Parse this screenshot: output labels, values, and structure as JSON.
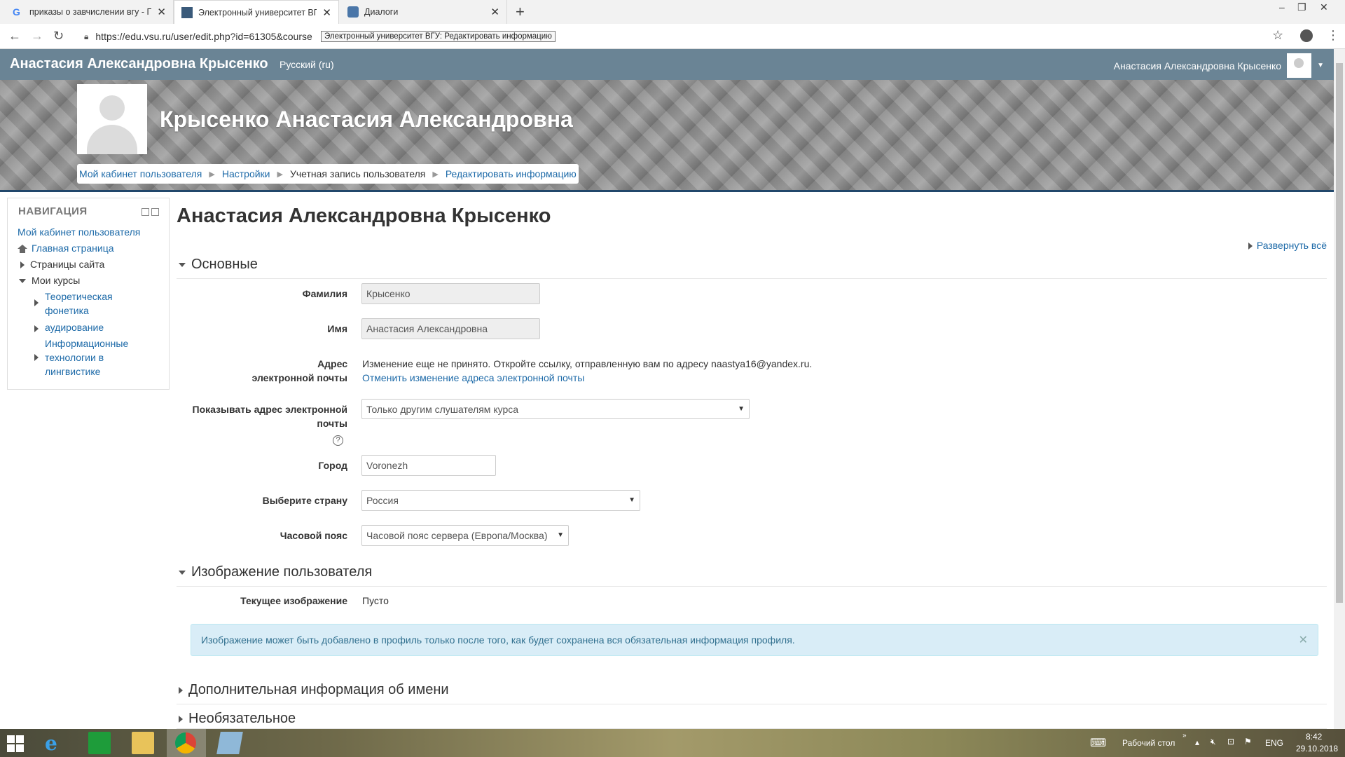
{
  "browser": {
    "tabs": [
      {
        "title": "приказы о завчислении вгу - По"
      },
      {
        "title": "Электронный университет ВГУ: Р"
      },
      {
        "title": "Диалоги"
      }
    ],
    "url": "https://edu.vsu.ru/user/edit.php?id=61305&course",
    "tooltip": "Электронный университет ВГУ: Редактировать информацию"
  },
  "topnav": {
    "site_name": "Анастасия Александровна Крысенко",
    "language": "Русский (ru)",
    "user_name": "Анастасия Александровна Крысенко"
  },
  "banner": {
    "title": "Крысенко Анастасия Александровна",
    "breadcrumb": [
      "Мой кабинет пользователя",
      "Настройки",
      "Учетная запись пользователя",
      "Редактировать информацию"
    ]
  },
  "navigation": {
    "title": "НАВИГАЦИЯ",
    "items": [
      "Мой кабинет пользователя",
      "Главная страница",
      "Страницы сайта",
      "Мои курсы",
      "Теоретическая",
      "фонетика",
      "аудирование",
      "Информационные",
      "технологии в",
      "лингвистике"
    ]
  },
  "main": {
    "heading": "Анастасия Александровна Крысенко",
    "expand_all": "Развернуть всё",
    "section_general": "Основные",
    "surname_label": "Фамилия",
    "surname_value": "Крысенко",
    "name_label": "Имя",
    "name_value": "Анастасия Александровна",
    "email_label_1": "Адрес",
    "email_label_2": "электронной почты",
    "email_notice": "Изменение еще не принято. Откройте ссылку, отправленную вам по адресу naastya16@yandex.ru.",
    "email_cancel": "Отменить изменение адреса электронной почты",
    "show_email_label_1": "Показывать адрес электронной",
    "show_email_label_2": "почты",
    "show_email_value": "Только другим слушателям курса",
    "city_label": "Город",
    "city_value": "Voronezh",
    "country_label": "Выберите страну",
    "country_value": "Россия",
    "timezone_label": "Часовой пояс",
    "timezone_value": "Часовой пояс сервера (Европа/Москва)",
    "section_picture": "Изображение пользователя",
    "current_picture_label": "Текущее изображение",
    "current_picture_value": "Пусто",
    "alert_text": "Изображение может быть добавлено в профиль только после того, как будет сохранена вся обязательная информация профиля.",
    "section_names": "Дополнительная информация об имени",
    "section_optional": "Необязательное"
  },
  "taskbar": {
    "desktop_label": "Рабочий стол",
    "lang": "ENG",
    "time": "8:42",
    "date": "29.10.2018"
  },
  "colors": {
    "link": "#1d6aa8",
    "navbar": "#506e82",
    "alert_bg": "#d9edf7"
  }
}
